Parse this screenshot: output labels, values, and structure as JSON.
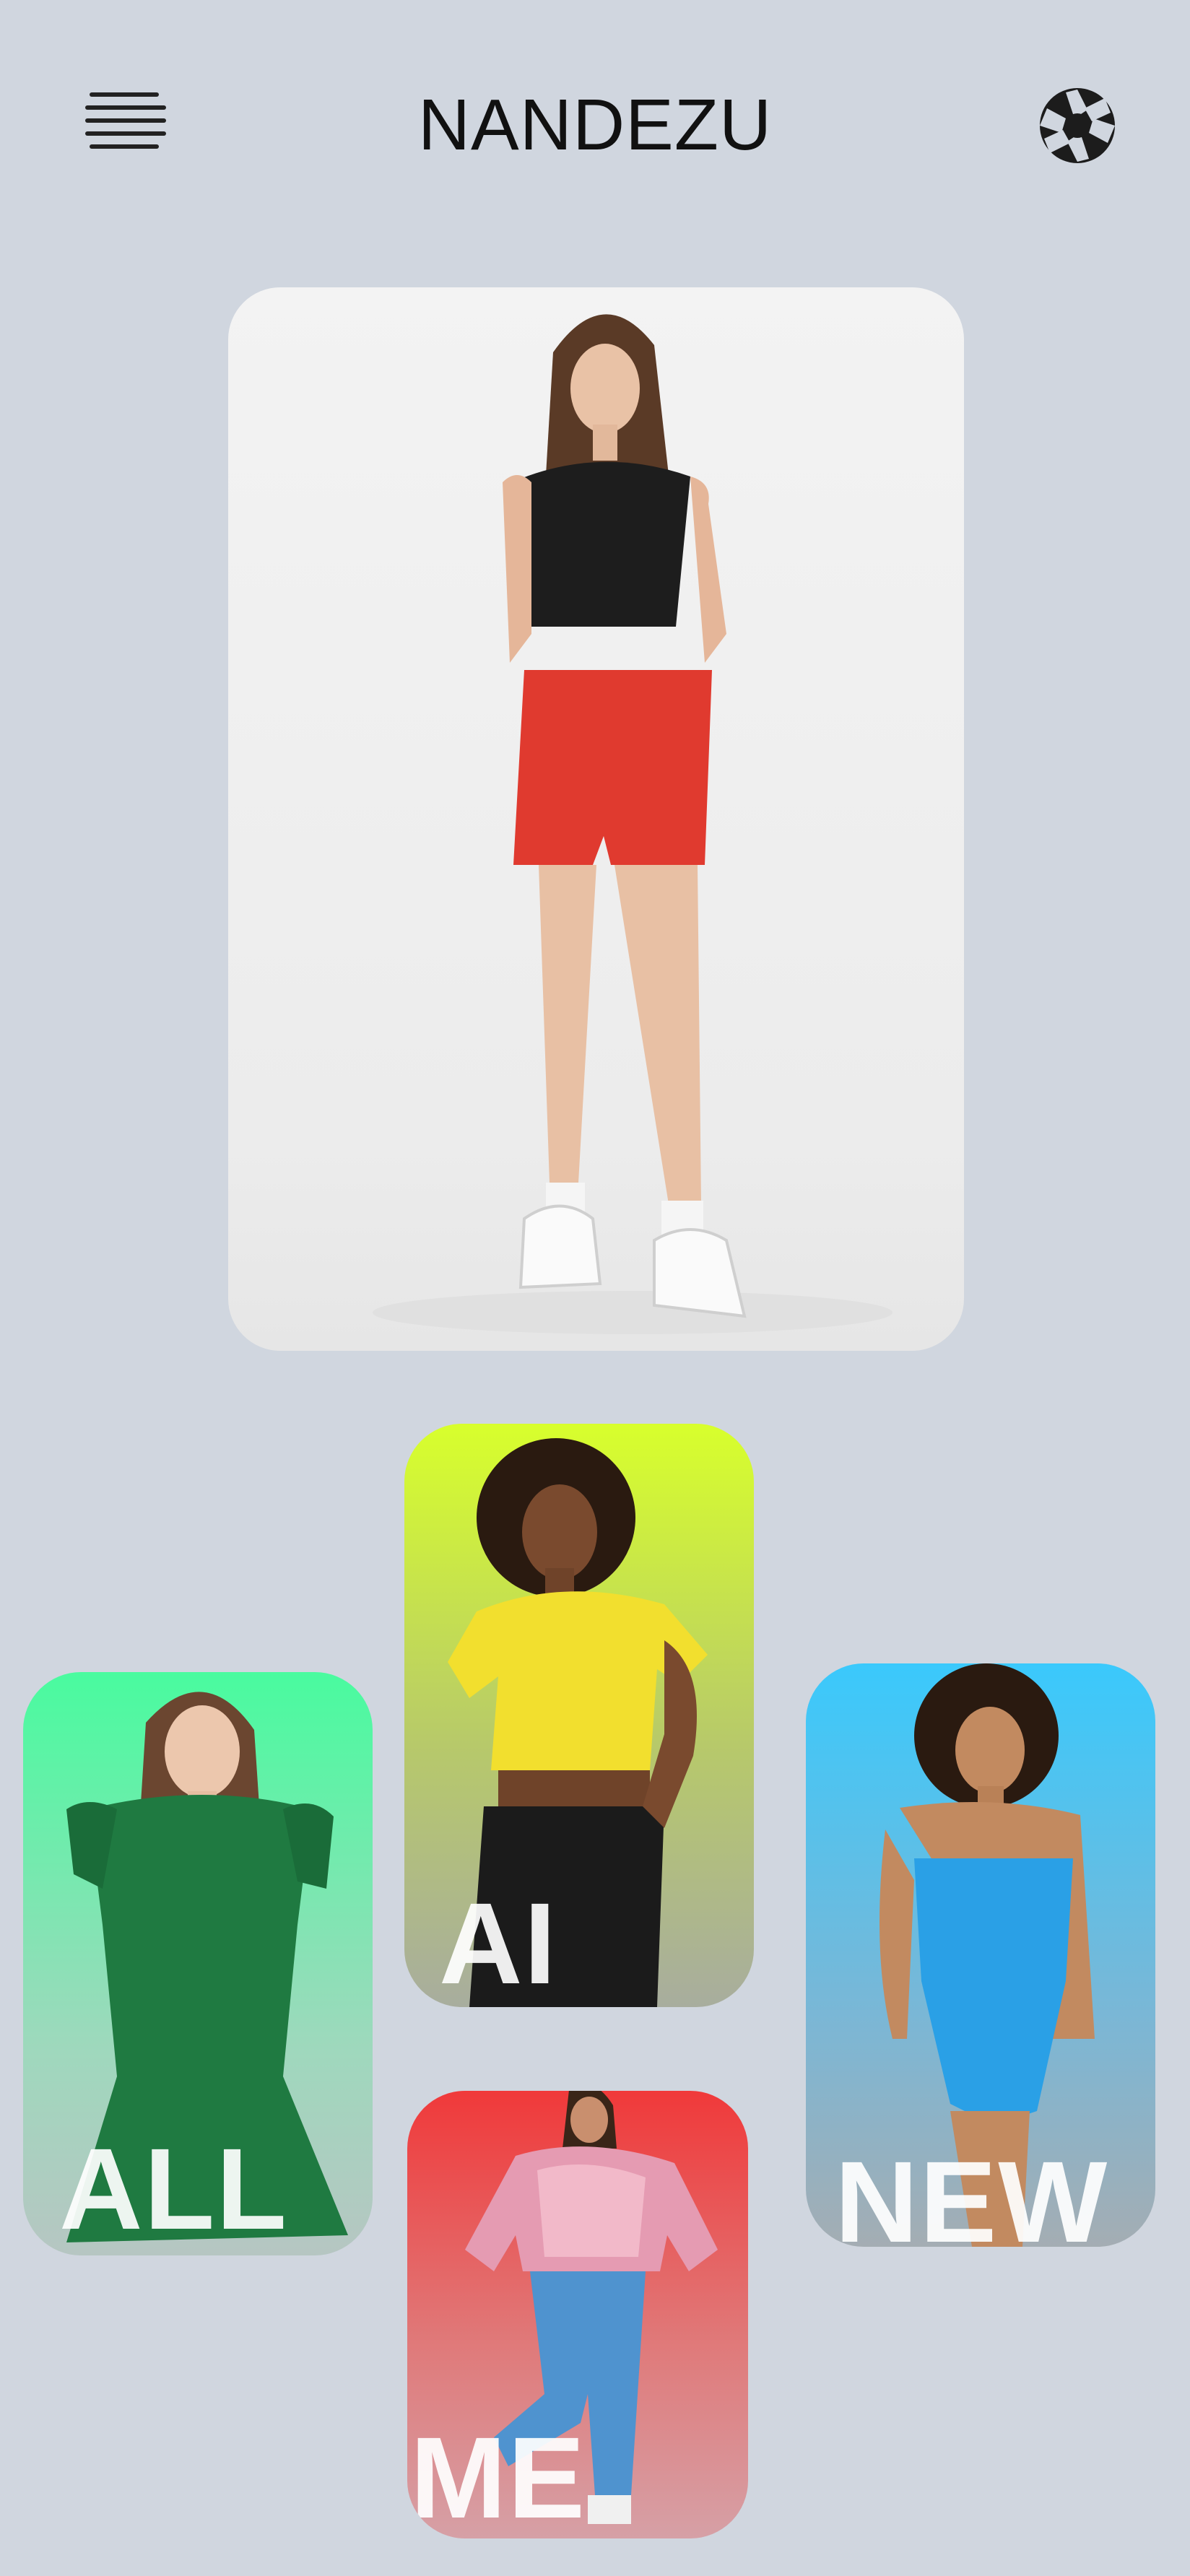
{
  "header": {
    "title": "NANDEZU",
    "menu_icon": "hamburger-menu-icon",
    "camera_icon": "camera-aperture-icon"
  },
  "hero": {
    "image": "model in black tank top and red shorts"
  },
  "tiles": {
    "ai": {
      "label": "AI"
    },
    "all": {
      "label": "ALL"
    },
    "new": {
      "label": "NEW"
    },
    "me": {
      "label": "ME"
    }
  },
  "colors": {
    "background": "#d0d6df",
    "ai_tile_top": "#d8ff2c",
    "all_tile_top": "#49fb9f",
    "new_tile_top": "#3ac9fc",
    "me_tile_top": "#f0393a"
  }
}
